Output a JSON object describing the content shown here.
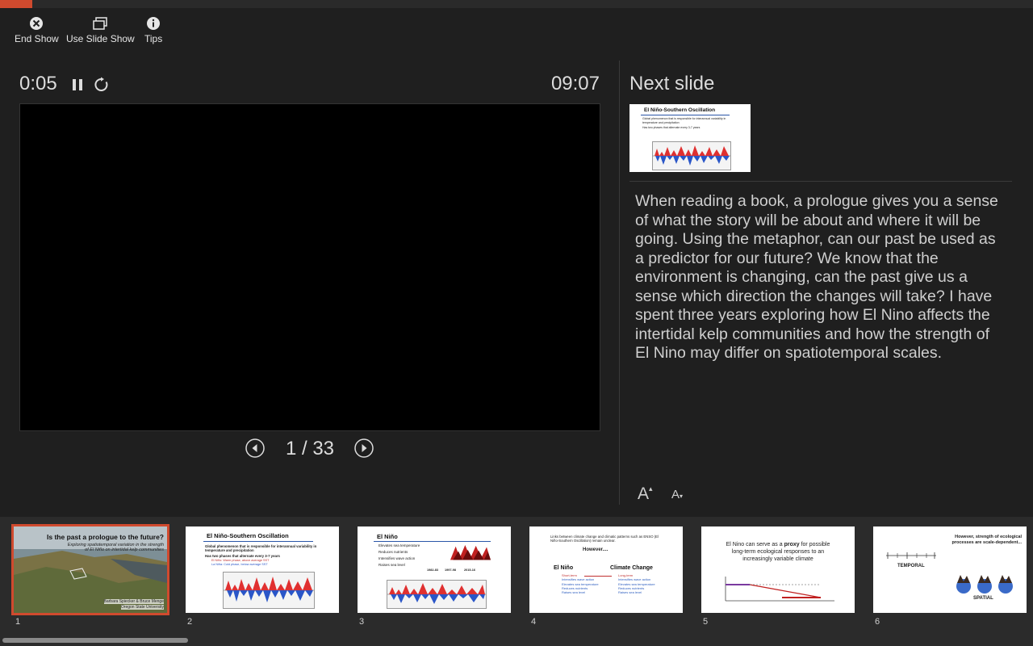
{
  "toolbar": {
    "end_show": "End Show",
    "use_slide_show": "Use Slide Show",
    "tips": "Tips"
  },
  "presenter": {
    "elapsed": "0:05",
    "clock": "09:07",
    "current_slide": 1,
    "total_slides": 33,
    "slide_counter": "1 / 33"
  },
  "next_slide": {
    "heading": "Next slide",
    "title": "El Niño-Southern Oscillation"
  },
  "notes": {
    "text": "When reading a book, a prologue gives you a sense of what the story will be about and where it will be going. Using the metaphor, can our past be used as a predictor for our future? We know that the environment is changing, can the past give us a sense which direction the changes will take? I have spent three years exploring how El Nino affects the intertidal kelp communities and how the strength of El Nino may differ on spatiotemporal scales."
  },
  "font_controls": {
    "increase": "A",
    "decrease": "A"
  },
  "thumbnails": [
    {
      "num": "1",
      "title": "Is the past a prologue to the future?",
      "subtitle_1": "Exploring spatiotemporal variation in the strength",
      "subtitle_2": "of El Niño on intertidal kelp communities",
      "author": "Barbara Spiecker & Bruce Menge",
      "affiliation": "Oregon State University"
    },
    {
      "num": "2",
      "title": "El Niño-Southern Oscillation",
      "bullet_1": "Global phenomenon that is responsible for interannual variability in temperature and precipitation",
      "bullet_2": "Has two phases that alternate every 3-7 years",
      "sub_1": "El Niño: Warm phase, above average SST",
      "sub_2": "La Niña: Cold phase, below average SST"
    },
    {
      "num": "3",
      "title": "El Niño",
      "b1": "Elevates sea temperature",
      "b2": "Reduces nutrients",
      "b3": "Intensifies wave action",
      "b4": "Raises sea level",
      "years_1": "1982-83",
      "years_2": "1997-98",
      "years_3": "2015-16"
    },
    {
      "num": "4",
      "intro": "Links between climate change and climatic patterns such as ENSO (El Niño-Southern Oscillation) remain unclear.",
      "however": "However....",
      "col_left": "El Niño",
      "col_right": "Climate Change",
      "left_1": "Short-term",
      "left_2": "Intensifies wave action",
      "left_3": "Elevates sea temperature",
      "left_4": "Reduces nutrients",
      "left_5": "Raises sea level",
      "right_1": "Long-term",
      "right_2": "Intensifies wave action",
      "right_3": "Elevates sea temperature",
      "right_4": "Reduces nutrients",
      "right_5": "Raises sea level"
    },
    {
      "num": "5",
      "text_a": "El Nino can serve as a ",
      "text_bold": "proxy",
      "text_b": " for possible long-term ecological responses to an increasingly variable climate"
    },
    {
      "num": "6",
      "heading": "However, strength of ecological processes are scale-dependent...",
      "temporal": "TEMPORAL",
      "spatial": "SPATIAL"
    }
  ],
  "colors": {
    "accent": "#d04a2e",
    "background": "#1f1f1f",
    "strip": "#2b2b2b"
  }
}
